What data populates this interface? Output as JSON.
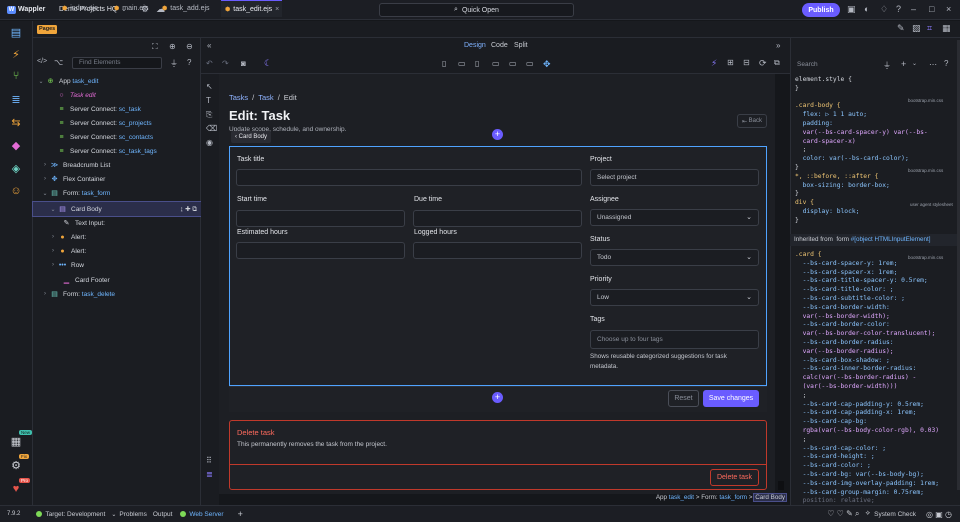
{
  "titlebar": {
    "app_name": "Wappler",
    "project": "Demo Projects HQ",
    "quick_open": "Quick Open",
    "publish": "Publish"
  },
  "tabs": {
    "pages_badge": "Pages",
    "items": [
      {
        "label": "index.ejs"
      },
      {
        "label": "main.ejs"
      },
      {
        "label": "task_add.ejs"
      },
      {
        "label": "task_edit.ejs"
      }
    ],
    "close": "×"
  },
  "view_modes": {
    "design": "Design",
    "code": "Code",
    "split": "Split"
  },
  "navigator": {
    "find_placeholder": "Find Elements",
    "tree": [
      {
        "label": "App",
        "suffix": "task_edit"
      },
      {
        "label": "Task edit",
        "suffix": ""
      },
      {
        "label": "Server Connect:",
        "suffix": "sc_task"
      },
      {
        "label": "Server Connect:",
        "suffix": "sc_projects"
      },
      {
        "label": "Server Connect:",
        "suffix": "sc_contacts"
      },
      {
        "label": "Server Connect:",
        "suffix": "sc_task_tags"
      },
      {
        "label": "Breadcrumb List",
        "suffix": ""
      },
      {
        "label": "Flex Container",
        "suffix": ""
      },
      {
        "label": "Form:",
        "suffix": "task_form"
      },
      {
        "label": "Card Body",
        "suffix": ""
      },
      {
        "label": "Text Input:",
        "suffix": ""
      },
      {
        "label": "Alert:",
        "suffix": ""
      },
      {
        "label": "Alert:",
        "suffix": ""
      },
      {
        "label": "Row",
        "suffix": ""
      },
      {
        "label": "Card Footer",
        "suffix": ""
      },
      {
        "label": "Form:",
        "suffix": "task_delete"
      }
    ]
  },
  "page": {
    "breadcrumb": [
      "Tasks",
      "/",
      "Task",
      "/",
      "Edit"
    ],
    "title": "Edit: Task",
    "subtitle": "Update scope, schedule, and ownership.",
    "card_body_tooltip": "Card Body",
    "back": "Back",
    "fields": {
      "task_title": "Task title",
      "start_time": "Start time",
      "due_time": "Due time",
      "estimated_hours": "Estimated hours",
      "logged_hours": "Logged hours",
      "project": "Project",
      "project_placeholder": "Select project",
      "assignee": "Assignee",
      "assignee_value": "Unassigned",
      "status": "Status",
      "status_value": "Todo",
      "priority": "Priority",
      "priority_value": "Low",
      "tags": "Tags",
      "tags_placeholder": "Choose up to four tags",
      "tags_help": "Shows reusable categorized suggestions for task metadata."
    },
    "reset": "Reset",
    "save": "Save changes",
    "delete_title": "Delete task",
    "delete_text": "This permanently removes the task from the project.",
    "delete_button": "Delete task"
  },
  "bottom_breadcrumb": {
    "app": "App",
    "app_suffix": "task_edit",
    "sep": ">",
    "form": "Form:",
    "form_suffix": "task_form",
    "current": "Card Body"
  },
  "styles": {
    "search_placeholder": "Search",
    "inherited": "Inherited from",
    "inherited_form": "form",
    "inherited_detail": "#[object HTMLInputElement]",
    "source_bootstrap": "bootstrap.min.css",
    "source_ua": "user agent stylesheet",
    "css_lines": [
      "element.style {",
      "}",
      ".card-body {",
      "  flex: ▷ 1 1 auto;",
      "  padding:",
      "  var(--bs-card-spacer-y) var(--bs-",
      "  card-spacer-x)",
      "  ;",
      "  color: var(--bs-card-color);",
      "}",
      "*, ::before, ::after {",
      "  box-sizing: border-box;",
      "}",
      "div {",
      "  display: block;",
      "}"
    ],
    "card_lines": [
      ".card {",
      "  --bs-card-spacer-y: 1rem;",
      "  --bs-card-spacer-x: 1rem;",
      "  --bs-card-title-spacer-y: 0.5rem;",
      "  --bs-card-title-color: ;",
      "  --bs-card-subtitle-color: ;",
      "  --bs-card-border-width:",
      "  var(--bs-border-width);",
      "  --bs-card-border-color:",
      "  var(--bs-border-color-translucent);",
      "  --bs-card-border-radius:",
      "  var(--bs-border-radius);",
      "  --bs-card-box-shadow: ;",
      "  --bs-card-inner-border-radius:",
      "  calc(var(--bs-border-radius) -",
      "  (var(--bs-border-width)))",
      "  ;",
      "  --bs-card-cap-padding-y: 0.5rem;",
      "  --bs-card-cap-padding-x: 1rem;",
      "  --bs-card-cap-bg:",
      "  rgba(var(--bs-body-color-rgb), 0.03)",
      "  ;",
      "  --bs-card-cap-color: ;",
      "  --bs-card-height: ;",
      "  --bs-card-color: ;",
      "  --bs-card-bg: var(--bs-body-bg);",
      "  --bs-card-img-overlay-padding: 1rem;",
      "  --bs-card-group-margin: 0.75rem;",
      "  position: relative;"
    ]
  },
  "statusbar": {
    "version": "7.9.2",
    "target": "Target:",
    "target_value": "Development",
    "problems": "Problems",
    "output": "Output",
    "web_server": "Web Server",
    "system_check": "System Check"
  },
  "badges": {
    "new": "New",
    "fix": "Fix",
    "pro": "Pro"
  },
  "colors": {
    "accent": "#6a5cff",
    "selection_outline": "#4fa3ff",
    "danger": "#c0392b"
  }
}
